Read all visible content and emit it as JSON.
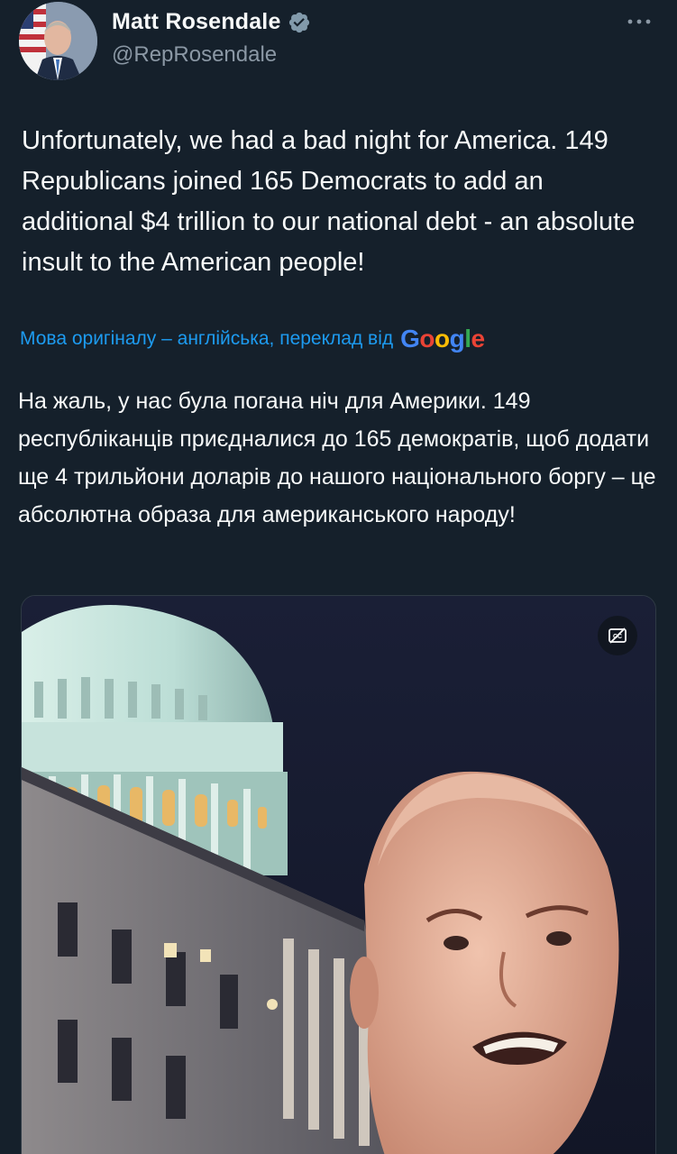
{
  "author": {
    "display_name": "Matt Rosendale",
    "handle": "@RepRosendale",
    "verified": true
  },
  "tweet": {
    "text": "Unfortunately, we had a bad night for America. 149 Republicans joined 165 Democrats to add an additional $4 trillion to our national debt - an absolute insult to the American people!"
  },
  "translation": {
    "label": "Мова оригіналу – англійська, переклад від",
    "provider": "Google",
    "text": "На жаль, у нас була погана ніч для Америки. 149 республіканців приєдналися до 165 демократів, щоб додати ще 4 трильйони доларів до нашого національного боргу – це абсолютна образа для американського народу!"
  },
  "icons": {
    "verified": "verified-badge-icon",
    "more": "more-options-icon",
    "captions": "captions-off-icon"
  },
  "colors": {
    "background": "#15202b",
    "link": "#1d9bf0",
    "secondary_text": "#8b98a5"
  }
}
